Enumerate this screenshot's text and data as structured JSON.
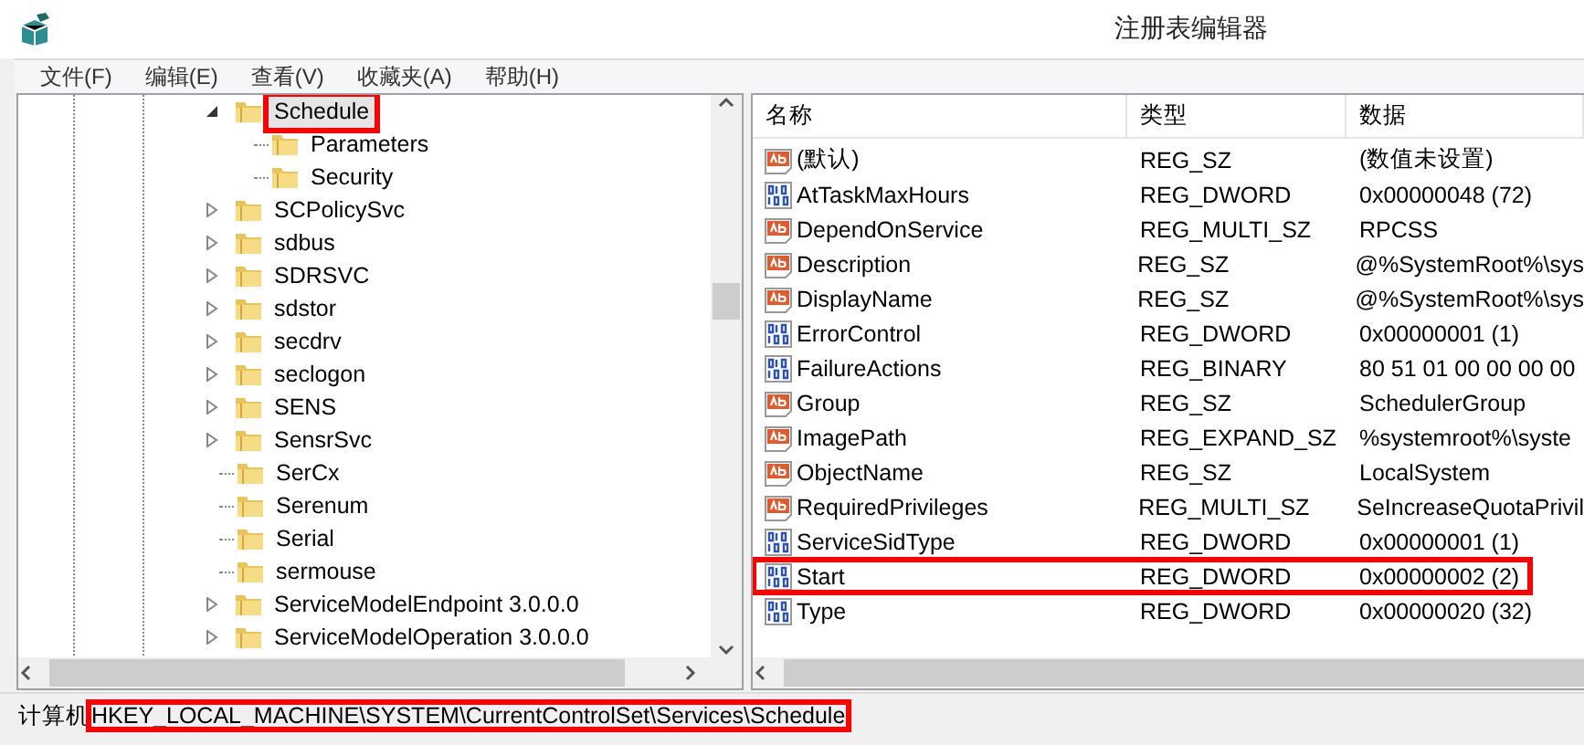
{
  "window": {
    "title": "注册表编辑器"
  },
  "menu": [
    "文件(F)",
    "编辑(E)",
    "查看(V)",
    "收藏夹(A)",
    "帮助(H)"
  ],
  "tree": [
    {
      "label": "Schedule",
      "expandable": true,
      "expanded": true,
      "selected": true,
      "highlighted": true,
      "children": [
        {
          "label": "Parameters",
          "expandable": false,
          "selected": false,
          "highlighted": false
        },
        {
          "label": "Security",
          "expandable": false,
          "selected": false,
          "highlighted": false
        }
      ]
    },
    {
      "label": "SCPolicySvc",
      "expandable": true,
      "expanded": false,
      "selected": false,
      "highlighted": false
    },
    {
      "label": "sdbus",
      "expandable": true,
      "expanded": false,
      "selected": false,
      "highlighted": false
    },
    {
      "label": "SDRSVC",
      "expandable": true,
      "expanded": false,
      "selected": false,
      "highlighted": false
    },
    {
      "label": "sdstor",
      "expandable": true,
      "expanded": false,
      "selected": false,
      "highlighted": false
    },
    {
      "label": "secdrv",
      "expandable": true,
      "expanded": false,
      "selected": false,
      "highlighted": false
    },
    {
      "label": "seclogon",
      "expandable": true,
      "expanded": false,
      "selected": false,
      "highlighted": false
    },
    {
      "label": "SENS",
      "expandable": true,
      "expanded": false,
      "selected": false,
      "highlighted": false
    },
    {
      "label": "SensrSvc",
      "expandable": true,
      "expanded": false,
      "selected": false,
      "highlighted": false
    },
    {
      "label": "SerCx",
      "expandable": false,
      "selected": false,
      "highlighted": false
    },
    {
      "label": "Serenum",
      "expandable": false,
      "selected": false,
      "highlighted": false
    },
    {
      "label": "Serial",
      "expandable": false,
      "selected": false,
      "highlighted": false
    },
    {
      "label": "sermouse",
      "expandable": false,
      "selected": false,
      "highlighted": false
    },
    {
      "label": "ServiceModelEndpoint 3.0.0.0",
      "expandable": true,
      "expanded": false,
      "selected": false,
      "highlighted": false
    },
    {
      "label": "ServiceModelOperation 3.0.0.0",
      "expandable": true,
      "expanded": false,
      "selected": false,
      "highlighted": false
    }
  ],
  "table": {
    "columns": [
      "名称",
      "类型",
      "数据"
    ],
    "rows": [
      {
        "kind": "string",
        "name": "(默认)",
        "type": "REG_SZ",
        "data": "(数值未设置)",
        "highlighted": false
      },
      {
        "kind": "binary",
        "name": "AtTaskMaxHours",
        "type": "REG_DWORD",
        "data": "0x00000048 (72)",
        "highlighted": false
      },
      {
        "kind": "string",
        "name": "DependOnService",
        "type": "REG_MULTI_SZ",
        "data": "RPCSS",
        "highlighted": false
      },
      {
        "kind": "string",
        "name": "Description",
        "type": "REG_SZ",
        "data": "@%SystemRoot%\\sys",
        "highlighted": false
      },
      {
        "kind": "string",
        "name": "DisplayName",
        "type": "REG_SZ",
        "data": "@%SystemRoot%\\sys",
        "highlighted": false
      },
      {
        "kind": "binary",
        "name": "ErrorControl",
        "type": "REG_DWORD",
        "data": "0x00000001 (1)",
        "highlighted": false
      },
      {
        "kind": "binary",
        "name": "FailureActions",
        "type": "REG_BINARY",
        "data": "80 51 01 00 00 00 00",
        "highlighted": false
      },
      {
        "kind": "string",
        "name": "Group",
        "type": "REG_SZ",
        "data": "SchedulerGroup",
        "highlighted": false
      },
      {
        "kind": "string",
        "name": "ImagePath",
        "type": "REG_EXPAND_SZ",
        "data": "%systemroot%\\syste",
        "highlighted": false
      },
      {
        "kind": "string",
        "name": "ObjectName",
        "type": "REG_SZ",
        "data": "LocalSystem",
        "highlighted": false
      },
      {
        "kind": "string",
        "name": "RequiredPrivileges",
        "type": "REG_MULTI_SZ",
        "data": "SeIncreaseQuotaPrivil",
        "highlighted": false
      },
      {
        "kind": "binary",
        "name": "ServiceSidType",
        "type": "REG_DWORD",
        "data": "0x00000001 (1)",
        "highlighted": false
      },
      {
        "kind": "binary",
        "name": "Start",
        "type": "REG_DWORD",
        "data": "0x00000002 (2)",
        "highlighted": true
      },
      {
        "kind": "binary",
        "name": "Type",
        "type": "REG_DWORD",
        "data": "0x00000020 (32)",
        "highlighted": false
      }
    ]
  },
  "status_bar": {
    "prefix": "计算机",
    "path": "HKEY_LOCAL_MACHINE\\SYSTEM\\CurrentControlSet\\Services\\Schedule",
    "highlighted": true
  }
}
